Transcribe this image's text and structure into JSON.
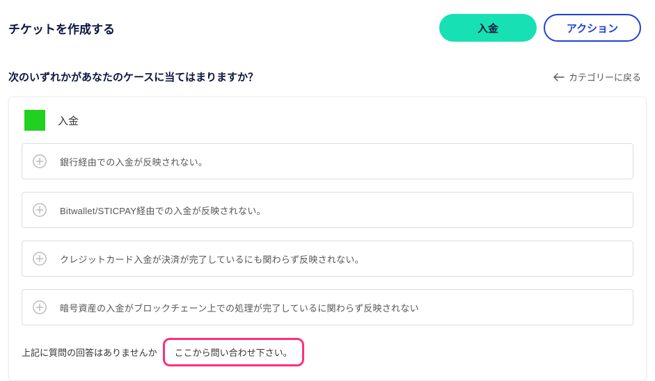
{
  "header": {
    "title": "チケットを作成する",
    "deposit_button": "入金",
    "action_button": "アクション"
  },
  "subheader": {
    "question": "次のいずれかがあなたのケースに当てはまりますか？",
    "back_label": "カテゴリーに戻る"
  },
  "category": {
    "label": "入金",
    "icon_color": "#22d11f"
  },
  "faq": [
    {
      "text": "銀行経由での入金が反映されない。"
    },
    {
      "text": "Bitwallet/STICPAY経由での入金が反映されない。"
    },
    {
      "text": "クレジットカード入金が決済が完了しているにも関わらず反映されない。"
    },
    {
      "text": "暗号資産の入金がブロックチェーン上での処理が完了しているに関わらず反映されない"
    }
  ],
  "footer": {
    "prompt": "上記に質問の回答はありませんか",
    "contact": "ここから問い合わせ下さい。"
  }
}
